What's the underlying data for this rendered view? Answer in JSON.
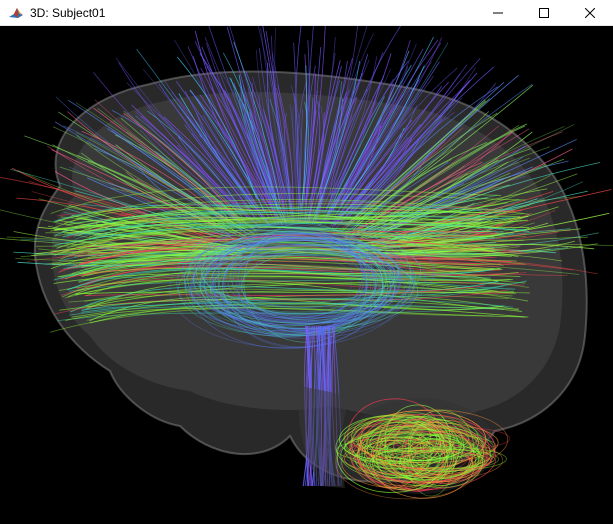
{
  "window": {
    "title": "3D: Subject01",
    "icon": "matlab-figure-icon",
    "controls": {
      "minimize_icon": "minimize-icon",
      "maximize_icon": "maximize-icon",
      "close_icon": "close-icon"
    }
  },
  "scene": {
    "description_icon": "brain-tractography-render",
    "background_color": "#000000",
    "shell_color": "#7a7a7a"
  }
}
